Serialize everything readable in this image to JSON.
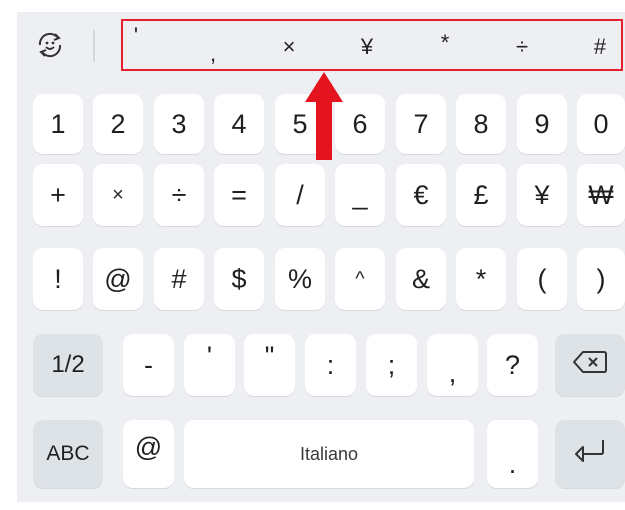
{
  "topbar": {
    "switch_icon": "smiley-refresh-icon",
    "symbols": [
      "'",
      ",",
      "×",
      "¥",
      "*",
      "÷",
      "#"
    ]
  },
  "rows": {
    "row1": [
      "1",
      "2",
      "3",
      "4",
      "5",
      "6",
      "7",
      "8",
      "9",
      "0"
    ],
    "row2": [
      "+",
      "×",
      "÷",
      "=",
      "/",
      "_",
      "€",
      "£",
      "¥",
      "₩"
    ],
    "row3": [
      "!",
      "@",
      "#",
      "$",
      "%",
      "^",
      "&",
      "*",
      "(",
      ")"
    ],
    "row4": {
      "page": "1/2",
      "keys": [
        "-",
        "'",
        "\"",
        ":",
        ";",
        ",",
        "?"
      ],
      "backspace_icon": "backspace-icon"
    },
    "row5": {
      "abc": "ABC",
      "at": "@",
      "space": "Italiano",
      "period": ".",
      "enter_icon": "enter-icon"
    }
  },
  "colors": {
    "highlight": "#e0202a",
    "keyboard_bg": "#edeff2",
    "key_bg": "#ffffff",
    "fn_key_bg": "#dde2e7"
  },
  "annotation": {
    "arrow_icon": "red-up-arrow-icon"
  }
}
